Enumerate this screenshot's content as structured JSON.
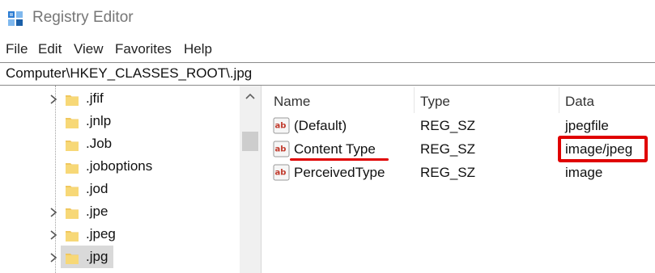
{
  "window": {
    "title": "Registry Editor"
  },
  "menu": {
    "items": [
      "File",
      "Edit",
      "View",
      "Favorites",
      "Help"
    ]
  },
  "address": {
    "path": "Computer\\HKEY_CLASSES_ROOT\\.jpg"
  },
  "tree": {
    "items": [
      {
        "label": ".jfif",
        "expandable": true
      },
      {
        "label": ".jnlp",
        "expandable": false
      },
      {
        "label": ".Job",
        "expandable": false
      },
      {
        "label": ".joboptions",
        "expandable": false
      },
      {
        "label": ".jod",
        "expandable": false
      },
      {
        "label": ".jpe",
        "expandable": true
      },
      {
        "label": ".jpeg",
        "expandable": true
      },
      {
        "label": ".jpg",
        "expandable": true,
        "selected": true
      }
    ]
  },
  "list": {
    "columns": [
      "Name",
      "Type",
      "Data"
    ],
    "rows": [
      {
        "name": "(Default)",
        "type": "REG_SZ",
        "data": "jpegfile"
      },
      {
        "name": "Content Type",
        "type": "REG_SZ",
        "data": "image/jpeg"
      },
      {
        "name": "PerceivedType",
        "type": "REG_SZ",
        "data": "image"
      }
    ]
  },
  "annotations": {
    "color": "#e00000"
  },
  "colors": {
    "folder": "#f0c75e",
    "selection": "#d9d9d9",
    "value_icon_red": "#c0392b"
  }
}
